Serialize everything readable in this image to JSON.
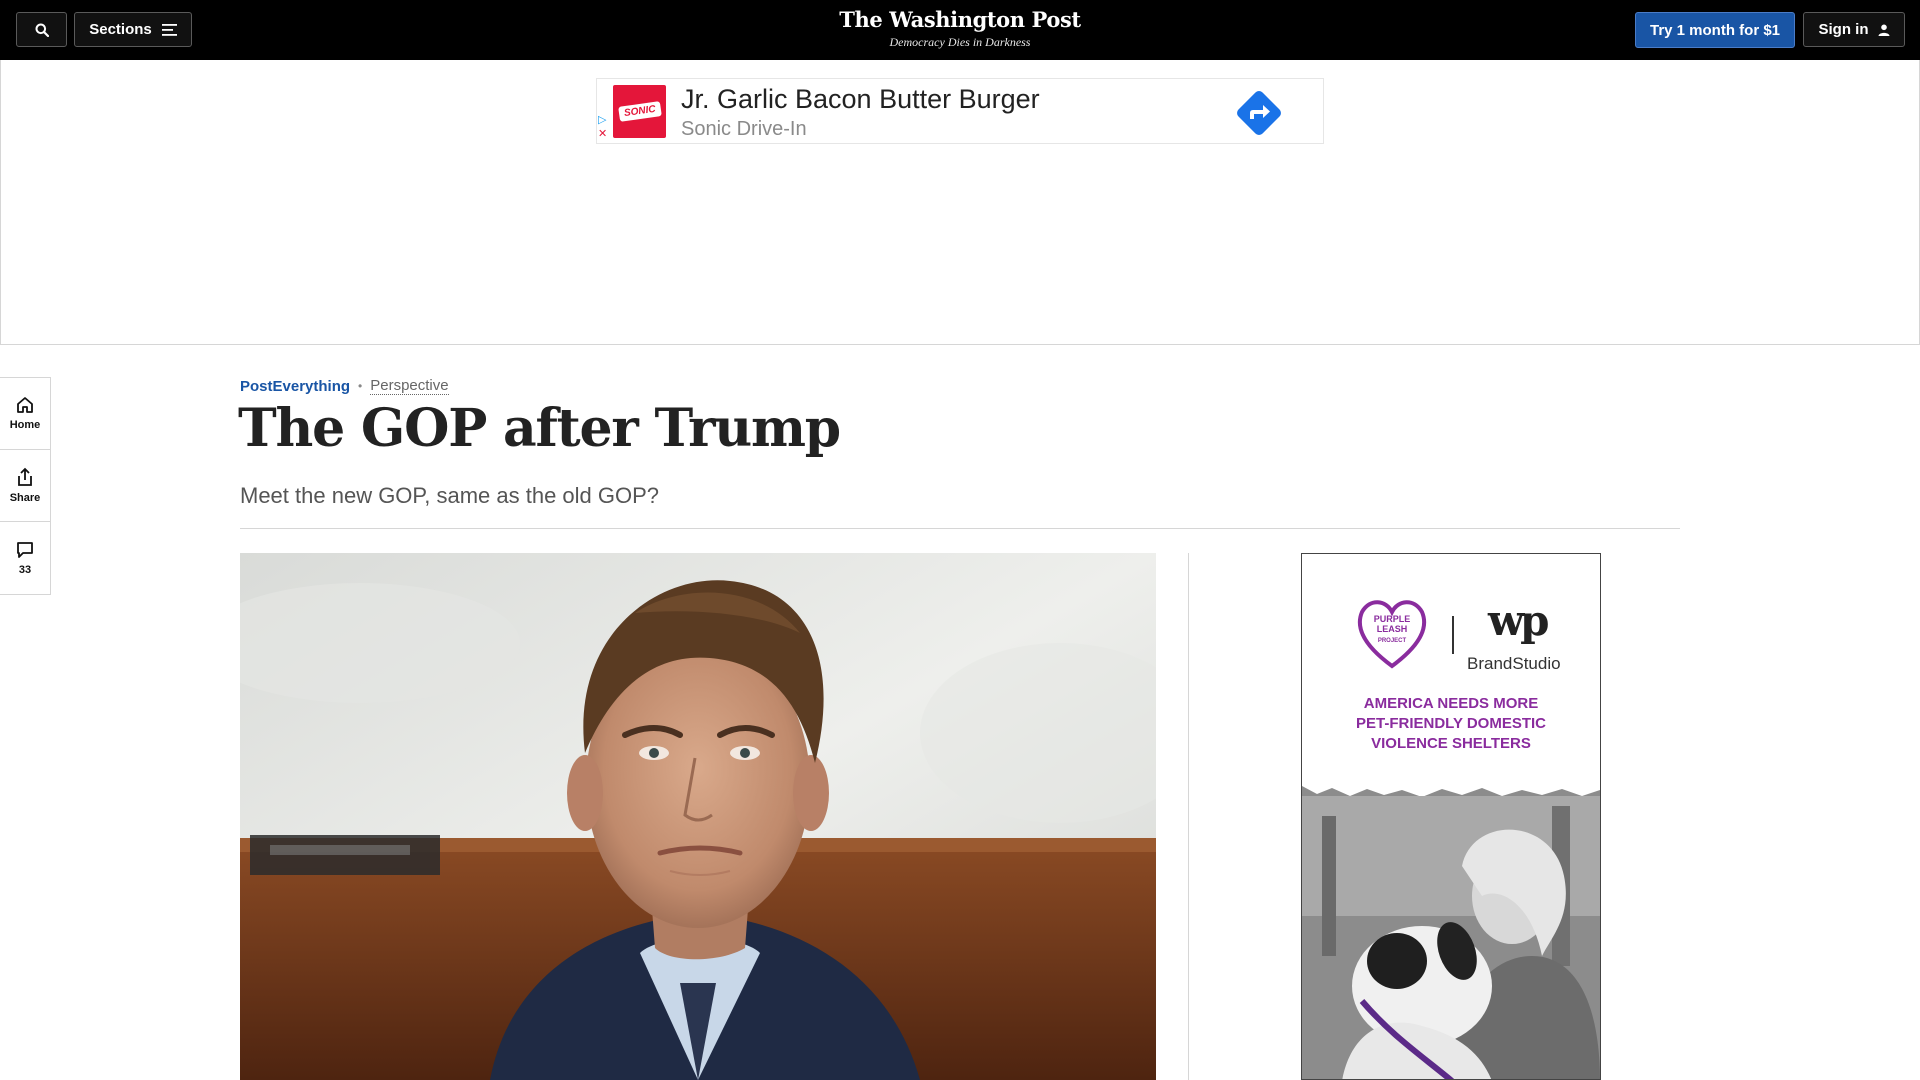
{
  "header": {
    "sections_label": "Sections",
    "logo_text": "The Washington Post",
    "tagline": "Democracy Dies in Darkness",
    "subscribe_label": "Try 1 month for $1",
    "signin_label": "Sign in"
  },
  "top_ad": {
    "logo_text": "SONIC",
    "title": "Jr. Garlic Bacon Butter Burger",
    "advertiser": "Sonic Drive-In",
    "brand_color": "#e4163a",
    "cta_color": "#1a73e8"
  },
  "rail": {
    "home_label": "Home",
    "share_label": "Share",
    "comments_count": "33"
  },
  "article": {
    "section": "PostEverything",
    "label": "Perspective",
    "headline": "The GOP after Trump",
    "dek": "Meet the new GOP, same as the old GOP?"
  },
  "side_ad": {
    "sponsor_line1": "PURPLE",
    "sponsor_line2": "LEASH",
    "sponsor_line3": "PROJECT",
    "partner": "BrandStudio",
    "partner_logo": "wp",
    "pitch_line1": "AMERICA NEEDS MORE",
    "pitch_line2": "PET-FRIENDLY DOMESTIC",
    "pitch_line3": "VIOLENCE SHELTERS",
    "accent_color": "#8a2c9e"
  },
  "colors": {
    "accent_blue": "#1955a5",
    "topbar": "#000000"
  }
}
